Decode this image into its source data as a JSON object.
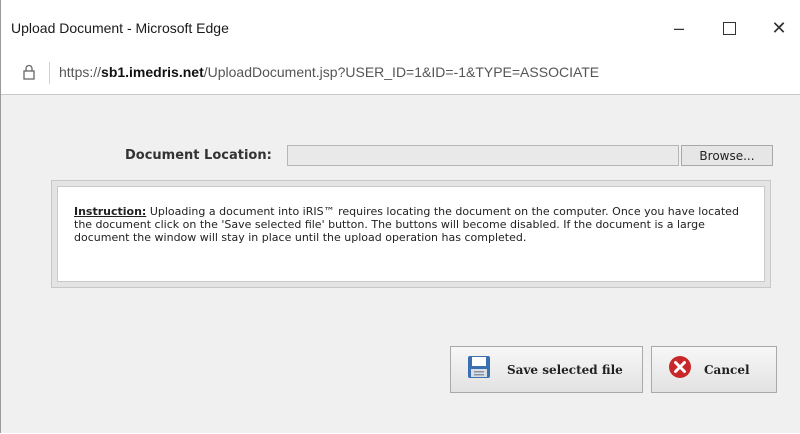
{
  "window": {
    "title": "Upload Document - Microsoft Edge",
    "controls": {
      "minimize": "–",
      "close": "✕"
    }
  },
  "address": {
    "url_prefix": "https://",
    "url_domain": "sb1.imedris.net",
    "url_path": "/UploadDocument.jsp?USER_ID=1&ID=-1&TYPE=ASSOCIATE"
  },
  "form": {
    "document_location_label": "Document Location:",
    "file_value": "",
    "browse_label": "Browse..."
  },
  "instruction": {
    "heading": "Instruction:",
    "text": "Uploading a document into iRIS™ requires locating the document on the computer. Once you have located the document click on the 'Save selected file' button. The buttons will become disabled. If the document is a large document the window will stay in place until the upload operation has completed."
  },
  "actions": {
    "save_label": "Save selected file",
    "cancel_label": "Cancel"
  },
  "icons": {
    "lock": "lock-icon",
    "save": "floppy-disk-icon",
    "cancel": "cancel-x-icon"
  },
  "colors": {
    "content_bg": "#f0f0f0",
    "cancel_red": "#c8282a",
    "save_blue": "#3a6fb0"
  }
}
